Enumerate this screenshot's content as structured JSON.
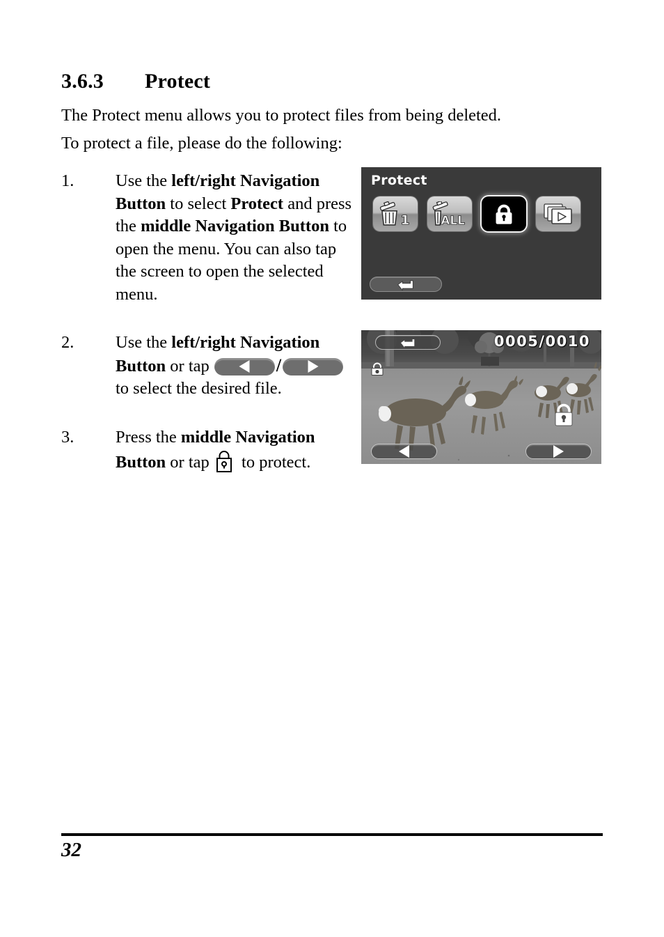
{
  "heading": {
    "number": "3.6.3",
    "title": "Protect"
  },
  "intro": {
    "line1": "The Protect menu allows you to protect files from being deleted.",
    "line2": "To protect a file, please do the following:"
  },
  "steps": [
    {
      "marker": "1.",
      "text_1": "Use the ",
      "bold_1": "left/right Navigation Button",
      "text_2": " to select ",
      "bold_2": "Protect",
      "text_3": " and press the ",
      "bold_3": "middle Navigation Button",
      "text_4": " to open the menu. You can also tap the screen to open the selected menu."
    },
    {
      "marker": "2.",
      "text_1": "Use the ",
      "bold_1": "left/right Navigation Button",
      "text_2": " or tap ",
      "separator": "/",
      "text_3": " to select the desired file."
    },
    {
      "marker": "3.",
      "text_1": "Press the ",
      "bold_1": "middle Navigation Button",
      "text_2": " or tap ",
      "text_3": " to protect."
    }
  ],
  "menu_screen": {
    "title": "Protect",
    "icons": [
      {
        "name": "delete-one-icon",
        "label": "1",
        "selected": false
      },
      {
        "name": "delete-all-icon",
        "label": "ALL",
        "selected": false
      },
      {
        "name": "protect-lock-icon",
        "label": "",
        "selected": true
      },
      {
        "name": "slideshow-icon",
        "label": "",
        "selected": false
      }
    ],
    "back_button": "return-icon"
  },
  "photo_screen": {
    "counter": "0005/0010",
    "back_button": "return-icon",
    "protect_badge": "protect-indicator-icon",
    "lock_button": "lock-icon",
    "prev_button": "previous-file-icon",
    "next_button": "next-file-icon"
  },
  "footer": {
    "page_number": "32"
  },
  "colors": {
    "menu_background": "#3a3a3a",
    "selected_highlight": "#ffffff",
    "pill_gray": "#6e6e6e",
    "text": "#000000"
  }
}
